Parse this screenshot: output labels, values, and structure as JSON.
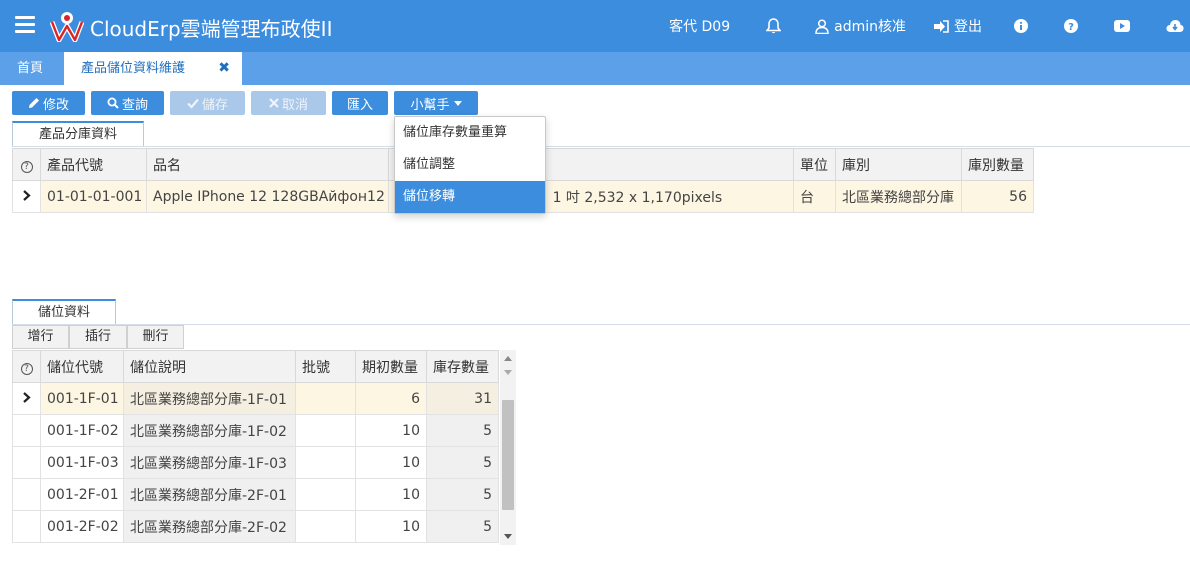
{
  "header": {
    "app_title": "CloudErp雲端管理布政使II",
    "account": "客代 D09",
    "user": "admin核准",
    "logout": "登出",
    "brand_color": "#3c8dde"
  },
  "tabs": {
    "home": "首頁",
    "active": "產品儲位資料維護"
  },
  "toolbar": {
    "edit": "修改",
    "query": "查詢",
    "save": "儲存",
    "cancel": "取消",
    "import": "匯入",
    "helper": "小幫手"
  },
  "helper_menu": [
    "儲位庫存數量重算",
    "儲位調整",
    "儲位移轉"
  ],
  "product_section": {
    "tab_label": "產品分庫資料",
    "columns": {
      "code": "產品代號",
      "name": "品名",
      "spec": "",
      "unit": "單位",
      "warehouse": "庫別",
      "qty": "庫別數量"
    },
    "row": {
      "code": "01-01-01-001",
      "name": "Apple IPhone 12 128GBАйфон12",
      "spec_prefix": "A",
      "spec": "1 吋 2,532 x 1,170pixels",
      "unit": "台",
      "warehouse": "北區業務總部分庫",
      "qty": "56"
    }
  },
  "location_section": {
    "tab_label": "儲位資料",
    "buttons": {
      "add": "增行",
      "insert": "插行",
      "delete": "刪行"
    },
    "columns": {
      "code": "儲位代號",
      "desc": "儲位說明",
      "batch": "批號",
      "init_qty": "期初數量",
      "stock_qty": "庫存數量"
    },
    "rows": [
      {
        "code": "001-1F-01",
        "desc": "北區業務總部分庫-1F-01",
        "batch": "",
        "init_qty": "6",
        "stock_qty": "31"
      },
      {
        "code": "001-1F-02",
        "desc": "北區業務總部分庫-1F-02",
        "batch": "",
        "init_qty": "10",
        "stock_qty": "5"
      },
      {
        "code": "001-1F-03",
        "desc": "北區業務總部分庫-1F-03",
        "batch": "",
        "init_qty": "10",
        "stock_qty": "5"
      },
      {
        "code": "001-2F-01",
        "desc": "北區業務總部分庫-2F-01",
        "batch": "",
        "init_qty": "10",
        "stock_qty": "5"
      },
      {
        "code": "001-2F-02",
        "desc": "北區業務總部分庫-2F-02",
        "batch": "",
        "init_qty": "10",
        "stock_qty": "5"
      }
    ]
  }
}
